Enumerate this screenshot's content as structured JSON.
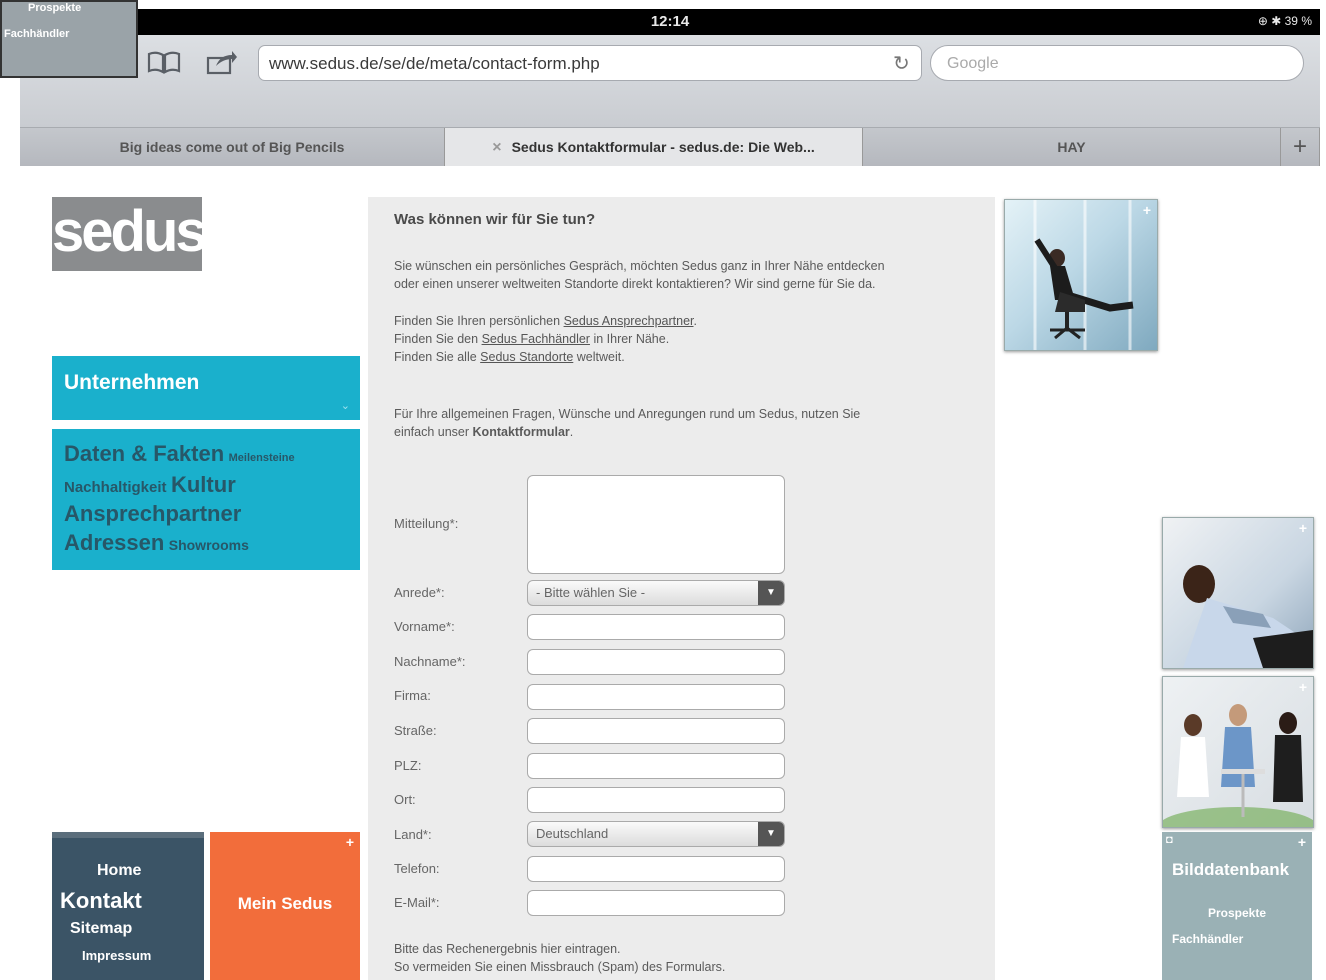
{
  "overlay": {
    "line1": "Prospekte",
    "line2": "Fachhändler"
  },
  "status": {
    "time": "12:14",
    "indicators": "⊕ ✱ 39 %"
  },
  "browser": {
    "url": "www.sedus.de/se/de/meta/contact-form.php",
    "search_placeholder": "Google",
    "tabs": [
      {
        "label": "Big ideas come out of Big Pencils"
      },
      {
        "label": "Sedus Kontaktformular - sedus.de: Die Web..."
      },
      {
        "label": "HAY"
      }
    ],
    "new_tab": "+",
    "close_tab": "×"
  },
  "logo": "sedus",
  "nav": {
    "unternehmen": "Unternehmen",
    "arrow": "⌄",
    "cloud": {
      "daten": "Daten & Fakten",
      "meilensteine": "Meilensteine",
      "nachhaltigkeit": "Nachhaltigkeit",
      "kultur": "Kultur",
      "ansprechpartner": "Ansprechpartner",
      "adressen": "Adressen",
      "showrooms": "Showrooms"
    }
  },
  "footer_nav": {
    "home": "Home",
    "kontakt": "Kontakt",
    "sitemap": "Sitemap",
    "impressum": "Impressum",
    "mein_sedus": "Mein Sedus"
  },
  "form": {
    "heading": "Was können wir für Sie tun?",
    "intro_1": "Sie wünschen ein persönliches Gespräch, möchten Sedus ganz in Ihrer Nähe entdecken",
    "intro_2": "oder einen unserer weltweiten Standorte direkt kontaktieren? Wir sind gerne für Sie da.",
    "find_1_pre": "Finden Sie Ihren persönlichen ",
    "find_1_link": "Sedus Ansprechpartner",
    "find_1_post": ".",
    "find_2_pre": "Finden Sie den ",
    "find_2_link": "Sedus Fachhändler",
    "find_2_post": " in Ihrer Nähe.",
    "find_3_pre": "Finden Sie alle ",
    "find_3_link": "Sedus Standorte",
    "find_3_post": " weltweit.",
    "general_1": "Für Ihre allgemeinen Fragen, Wünsche und Anregungen rund um Sedus, nutzen Sie",
    "general_2_pre": "einfach unser ",
    "general_2_bold": "Kontaktformular",
    "general_2_post": ".",
    "labels": {
      "mitteilung": "Mitteilung*:",
      "anrede": "Anrede*:",
      "vorname": "Vorname*:",
      "nachname": "Nachname*:",
      "firma": "Firma:",
      "strasse": "Straße:",
      "plz": "PLZ:",
      "ort": "Ort:",
      "land": "Land*:",
      "telefon": "Telefon:",
      "email": "E-Mail*:"
    },
    "anrede_value": "- Bitte wählen Sie -",
    "land_value": "Deutschland",
    "captcha_1": "Bitte das Rechenergebnis hier eintragen.",
    "captcha_2": "So vermeiden Sie einen Missbrauch (Spam) des Formulars."
  },
  "right": {
    "bilddatenbank": "Bilddatenbank",
    "prospekte": "Prospekte",
    "fachhaendler": "Fachhändler",
    "plus": "+"
  }
}
